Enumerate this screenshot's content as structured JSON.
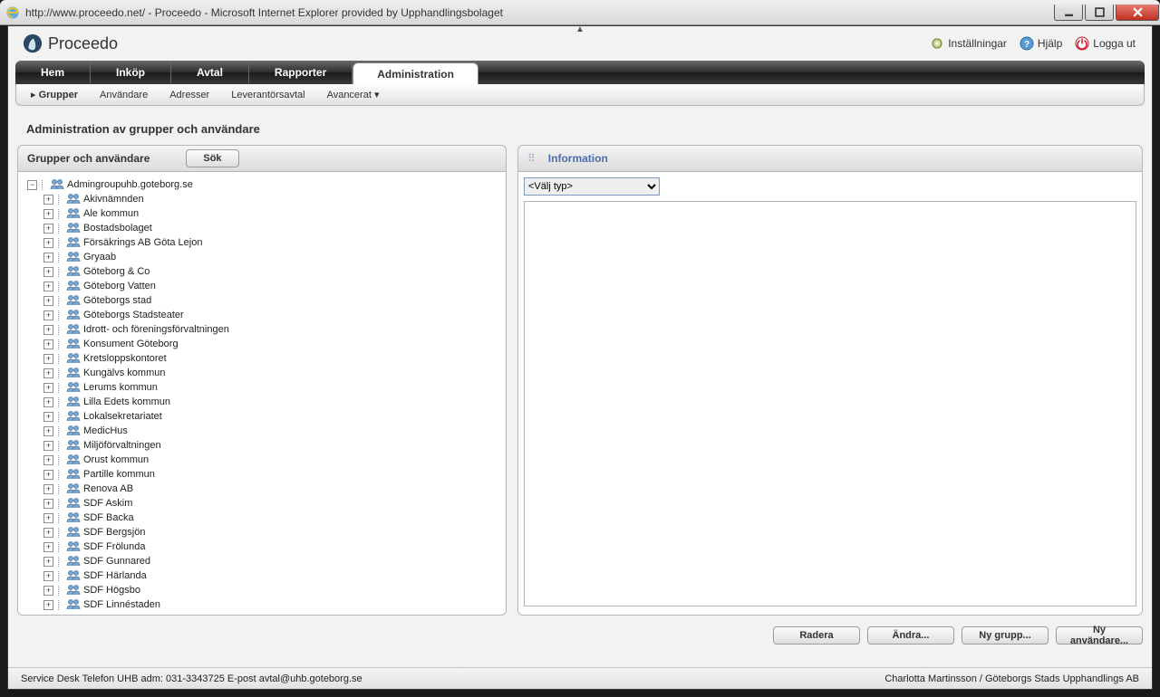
{
  "window": {
    "title": "http://www.proceedo.net/ - Proceedo - Microsoft Internet Explorer provided by Upphandlingsbolaget"
  },
  "brand": "Proceedo",
  "header_links": {
    "settings": "Inställningar",
    "help": "Hjälp",
    "logout": "Logga ut"
  },
  "main_tabs": [
    "Hem",
    "Inköp",
    "Avtal",
    "Rapporter",
    "Administration"
  ],
  "main_tab_active_index": 4,
  "sub_tabs": [
    "Grupper",
    "Användare",
    "Adresser",
    "Leverantörsavtal",
    "Avancerat ▾"
  ],
  "sub_tab_selected_index": 0,
  "page_title": "Administration av grupper och användare",
  "left_panel": {
    "title": "Grupper och användare",
    "search_button": "Sök"
  },
  "right_panel": {
    "title": "Information",
    "select_placeholder": "<Välj typ>"
  },
  "tree": {
    "root": "Admingroupuhb.goteborg.se",
    "children": [
      "Akivnämnden",
      "Ale kommun",
      "Bostadsbolaget",
      "Försäkrings AB Göta Lejon",
      "Gryaab",
      "Göteborg & Co",
      "Göteborg Vatten",
      "Göteborgs stad",
      "Göteborgs Stadsteater",
      "Idrott- och föreningsförvaltningen",
      "Konsument Göteborg",
      "Kretsloppskontoret",
      "Kungälvs kommun",
      "Lerums kommun",
      "Lilla Edets kommun",
      "Lokalsekretariatet",
      "MedicHus",
      "Miljöförvaltningen",
      "Orust kommun",
      "Partille kommun",
      "Renova AB",
      "SDF Askim",
      "SDF Backa",
      "SDF Bergsjön",
      "SDF Frölunda",
      "SDF Gunnared",
      "SDF Härlanda",
      "SDF Högsbo",
      "SDF Linnéstaden"
    ]
  },
  "actions": {
    "delete": "Radera",
    "edit": "Ändra...",
    "new_group": "Ny grupp...",
    "new_user": "Ny användare..."
  },
  "footer": {
    "left": "Service Desk Telefon UHB adm: 031-3343725   E-post avtal@uhb.goteborg.se",
    "right": "Charlotta Martinsson / Göteborgs Stads Upphandlings AB"
  }
}
